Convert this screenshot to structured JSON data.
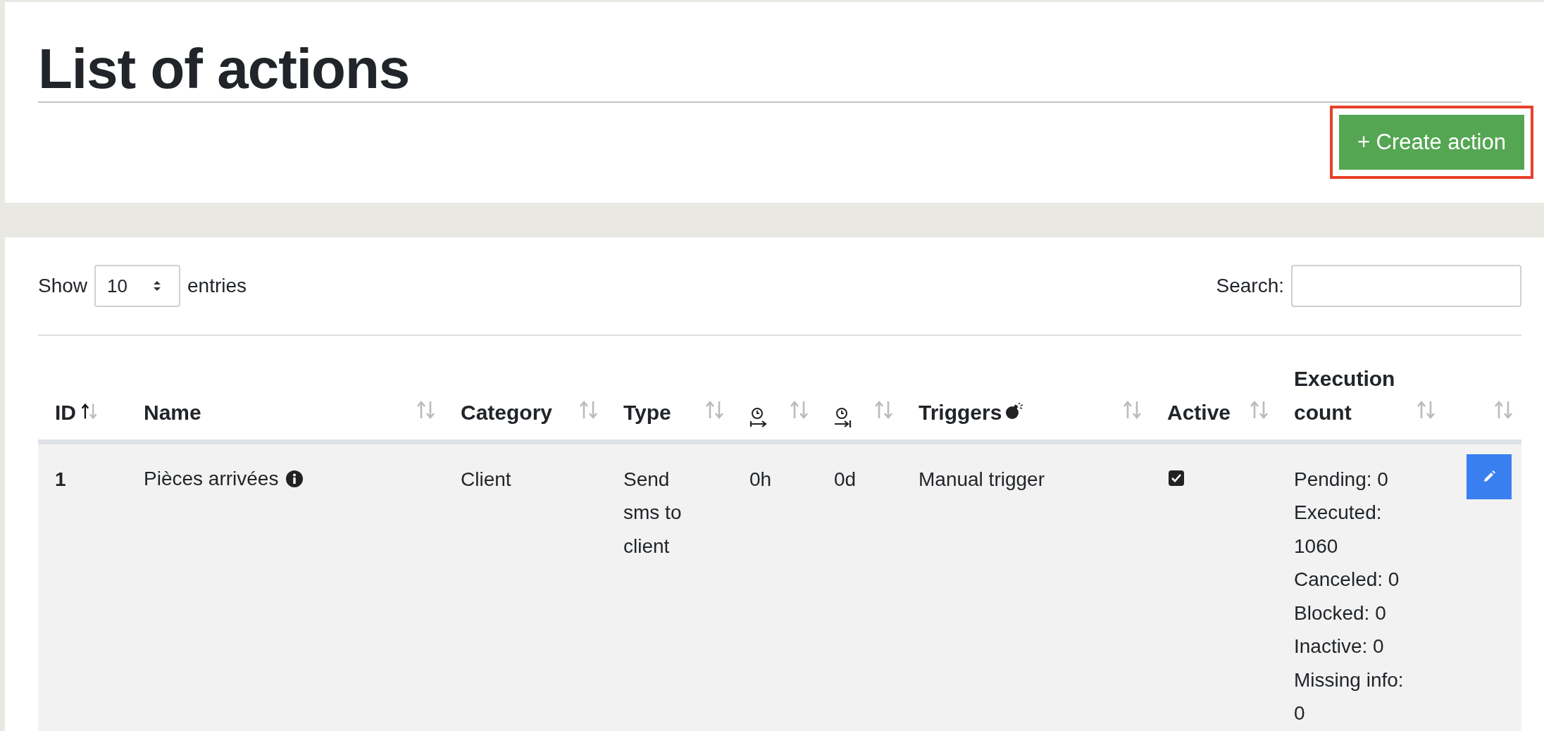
{
  "page_title": "List of actions",
  "create_button": {
    "label": "+ Create action",
    "highlighted": true
  },
  "length_control": {
    "before": "Show",
    "value": "10",
    "after": "entries"
  },
  "search": {
    "label": "Search:"
  },
  "table": {
    "columns": [
      {
        "kind": "text",
        "label": "ID",
        "sorted_ascending": true
      },
      {
        "kind": "text",
        "label": "Name",
        "sorted_ascending": false
      },
      {
        "kind": "text",
        "label": "Category",
        "sorted_ascending": false
      },
      {
        "kind": "text",
        "label": "Type",
        "sorted_ascending": false
      },
      {
        "kind": "timer_start",
        "sorted_ascending": false
      },
      {
        "kind": "timer_end",
        "sorted_ascending": false
      },
      {
        "kind": "text_bomb",
        "label": "Triggers",
        "sorted_ascending": false
      },
      {
        "kind": "text",
        "label": "Active",
        "sorted_ascending": false
      },
      {
        "kind": "text",
        "label": "Execution count",
        "sorted_ascending": false
      },
      {
        "kind": "blank",
        "sorted_ascending": false
      }
    ],
    "rows": [
      {
        "id": "1",
        "name": "Pièces arrivées",
        "info": true,
        "category": "Client",
        "type": "Send sms to client",
        "column_5": "0h",
        "column_6": "0d",
        "triggers": "Manual trigger",
        "active": true,
        "execution_count": [
          "Pending: 0",
          "Executed: 1060",
          "Canceled: 0",
          "Blocked: 0",
          "Inactive: 0",
          "Missing info: 0"
        ]
      }
    ]
  }
}
